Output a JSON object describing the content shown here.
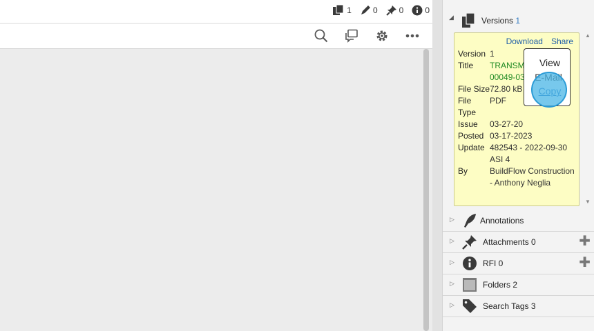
{
  "header": {
    "counters": [
      {
        "icon": "documents-icon",
        "count": "1"
      },
      {
        "icon": "pen-icon",
        "count": "0"
      },
      {
        "icon": "pin-icon",
        "count": "0"
      },
      {
        "icon": "info-icon",
        "count": "0"
      }
    ]
  },
  "toolbar": {
    "icons": [
      "search-icon",
      "comments-icon",
      "gear-icon",
      "more-icon"
    ]
  },
  "versions": {
    "label": "Versions",
    "count": "1",
    "links": {
      "download": "Download",
      "share": "Share"
    },
    "fields": [
      {
        "key": "Version",
        "value": "1"
      },
      {
        "key": "Title",
        "value": "TRANSM\n00049-03"
      },
      {
        "key": "File Size",
        "value": "72.80 kB"
      },
      {
        "key": "File Type",
        "value": "PDF"
      },
      {
        "key": "Issue",
        "value": "03-27-20"
      },
      {
        "key": "Posted",
        "value": "03-17-2023"
      },
      {
        "key": "Update",
        "value": "482543 - 2022-09-30 ASI 4"
      },
      {
        "key": "By",
        "value": "BuildFlow Construction - Anthony Neglia"
      }
    ]
  },
  "context_menu": {
    "view": "View",
    "email": "E-Mail",
    "copy": "Copy"
  },
  "sections": [
    {
      "label": "Annotations",
      "icon": "feather-icon",
      "plus": false
    },
    {
      "label": "Attachments 0",
      "icon": "pin-icon",
      "plus": true
    },
    {
      "label": "RFI 0",
      "icon": "info-icon",
      "plus": true
    },
    {
      "label": "Folders 2",
      "icon": "folder-icon",
      "plus": false
    },
    {
      "label": "Search Tags 3",
      "icon": "tag-icon",
      "plus": false
    }
  ],
  "colors": {
    "accent": "#2f79c2",
    "card_bg": "#fdfdc4",
    "title_green": "#1f8a23",
    "click_highlight": "#4ab6e6"
  }
}
